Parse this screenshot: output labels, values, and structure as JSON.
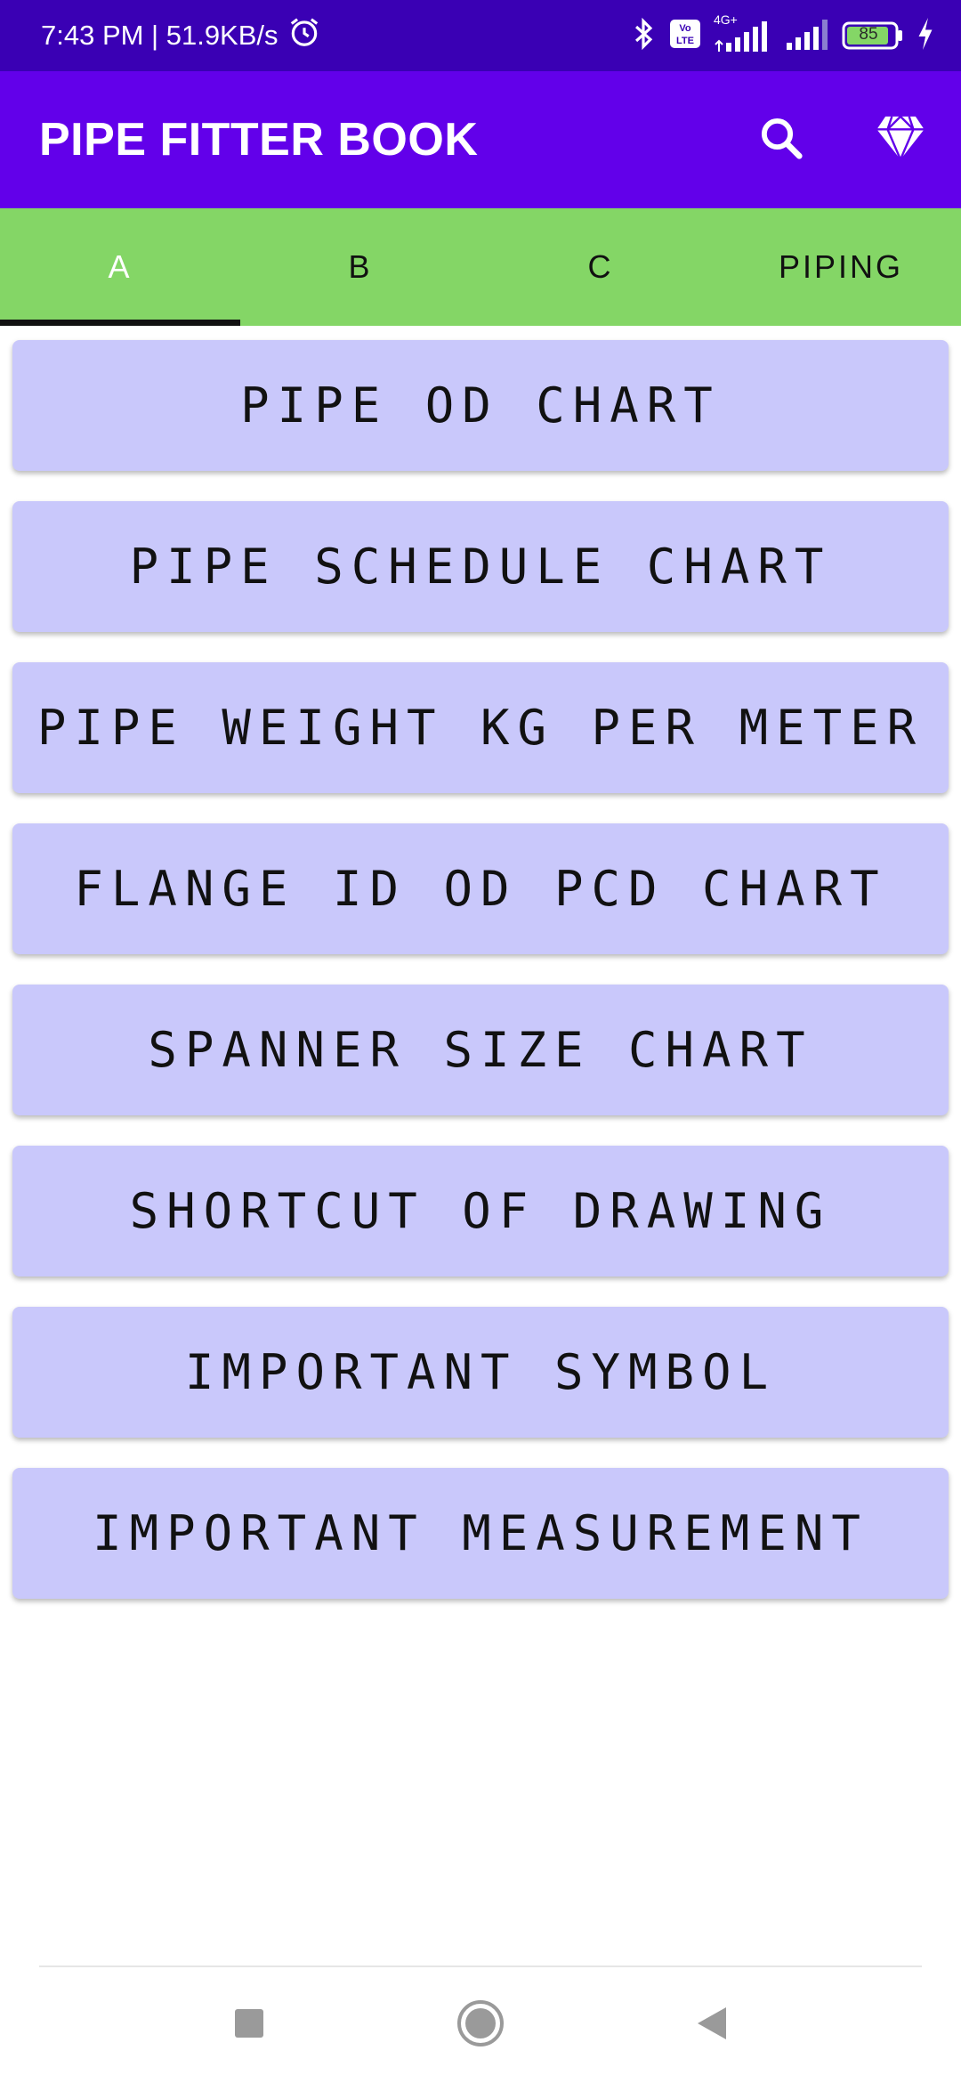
{
  "status_bar": {
    "time_speed": "7:43 PM | 51.9KB/s",
    "network_label": "4G+",
    "volte_label": "Vo\nLTE",
    "battery": "85"
  },
  "app_bar": {
    "title": "PIPE FITTER BOOK",
    "icons": [
      "search-icon",
      "diamond-icon"
    ]
  },
  "tabs": [
    {
      "label": "A",
      "active": true
    },
    {
      "label": "B",
      "active": false
    },
    {
      "label": "C",
      "active": false
    },
    {
      "label": "PIPING",
      "active": false
    }
  ],
  "items": [
    {
      "label": "PIPE OD CHART"
    },
    {
      "label": "PIPE SCHEDULE CHART"
    },
    {
      "label": "PIPE WEIGHT KG PER METER"
    },
    {
      "label": "FLANGE ID OD PCD CHART"
    },
    {
      "label": "SPANNER SIZE CHART"
    },
    {
      "label": "SHORTCUT OF DRAWING"
    },
    {
      "label": "IMPORTANT SYMBOL"
    },
    {
      "label": "IMPORTANT MEASUREMENT"
    }
  ],
  "colors": {
    "status_bar": "#3a00b4",
    "app_bar": "#6200ea",
    "tab_bar": "#84d666",
    "button_bg": "#c9c8fb"
  }
}
